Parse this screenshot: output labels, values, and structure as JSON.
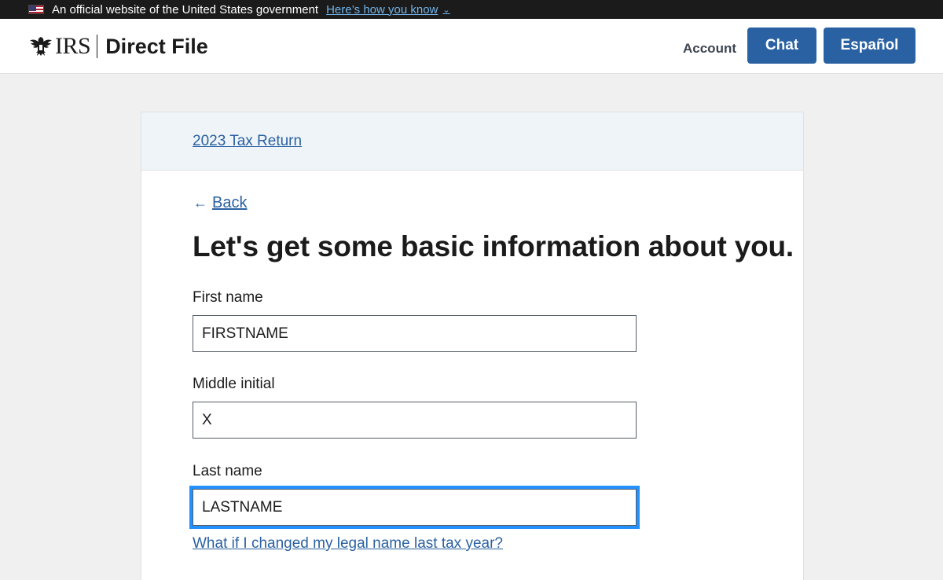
{
  "gov_banner": {
    "text": "An official website of the United States government",
    "link": "Here’s how you know"
  },
  "header": {
    "logo_text": "IRS",
    "product_name": "Direct File",
    "account_label": "Account",
    "chat_label": "Chat",
    "espanol_label": "Español"
  },
  "card": {
    "breadcrumb": "2023 Tax Return",
    "back_label": "Back",
    "title": "Let's get some basic information about you.",
    "fields": {
      "first_name": {
        "label": "First name",
        "value": "FIRSTNAME"
      },
      "middle_initial": {
        "label": "Middle initial",
        "value": "X"
      },
      "last_name": {
        "label": "Last name",
        "value": "LASTNAME"
      }
    },
    "help_link": "What if I changed my legal name last tax year?"
  },
  "colors": {
    "primary": "#2a61a2",
    "focus": "#2491ff",
    "banner_bg": "#1b1b1b",
    "card_header_bg": "#eff4f8"
  },
  "icons": {
    "flag": "us-flag-icon",
    "eagle": "irs-eagle-icon",
    "chevron": "chevron-down-icon",
    "back": "arrow-left-icon"
  }
}
